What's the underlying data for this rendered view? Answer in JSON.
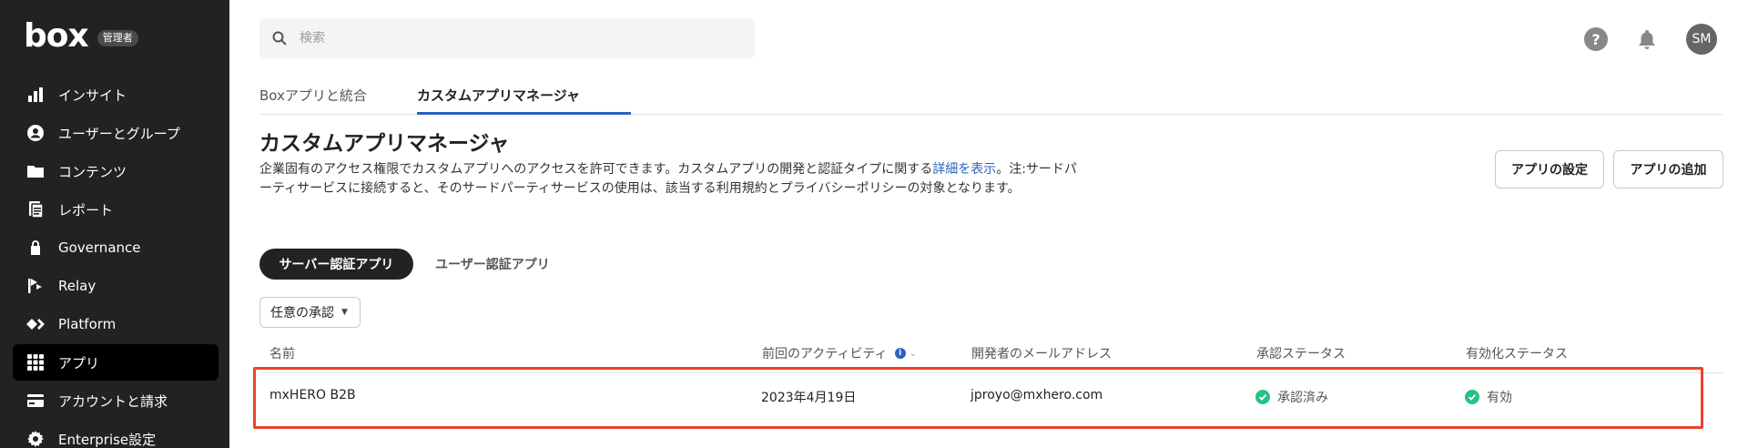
{
  "sidebar": {
    "logo": "box",
    "admin_badge": "管理者",
    "items": [
      {
        "label": "インサイト",
        "icon": "insights-icon"
      },
      {
        "label": "ユーザーとグループ",
        "icon": "user-icon"
      },
      {
        "label": "コンテンツ",
        "icon": "folder-icon"
      },
      {
        "label": "レポート",
        "icon": "report-icon"
      },
      {
        "label": "Governance",
        "icon": "lock-icon"
      },
      {
        "label": "Relay",
        "icon": "relay-icon"
      },
      {
        "label": "Platform",
        "icon": "platform-icon"
      },
      {
        "label": "アプリ",
        "icon": "apps-grid-icon",
        "active": true
      },
      {
        "label": "アカウントと請求",
        "icon": "credit-card-icon"
      },
      {
        "label": "Enterprise設定",
        "icon": "gear-icon"
      }
    ]
  },
  "header": {
    "search_placeholder": "検索",
    "help": "?",
    "avatar_initials": "SM"
  },
  "tabs": [
    {
      "label": "Boxアプリと統合"
    },
    {
      "label": "カスタムアプリマネージャ",
      "active": true
    }
  ],
  "page": {
    "title": "カスタムアプリマネージャ",
    "desc_before_link": "企業固有のアクセス権限でカスタムアプリへのアクセスを許可できます。カスタムアプリの開発と認証タイプに関する",
    "desc_link": "詳細を表示",
    "desc_after_link": "。注:サードパーティサービスに接続すると、そのサードパーティサービスの使用は、該当する利用規約とプライバシーポリシーの対象となります。",
    "settings_button": "アプリの設定",
    "add_button": "アプリの追加"
  },
  "filters": {
    "server_auth": "サーバー認証アプリ",
    "user_auth": "ユーザー認証アプリ",
    "approval_dropdown": "任意の承認"
  },
  "table": {
    "columns": [
      "名前",
      "前回のアクティビティ",
      "開発者のメールアドレス",
      "承認ステータス",
      "有効化ステータス"
    ],
    "rows": [
      {
        "name": "mxHERO B2B",
        "last_activity": "2023年4月19日",
        "developer_email": "jproyo@mxhero.com",
        "approval_status": "承認済み",
        "enable_status": "有効"
      }
    ]
  },
  "colors": {
    "sidebar_bg": "#222222",
    "accent": "#2a62bd",
    "highlight_border": "#e8432b",
    "success": "#26c281"
  }
}
